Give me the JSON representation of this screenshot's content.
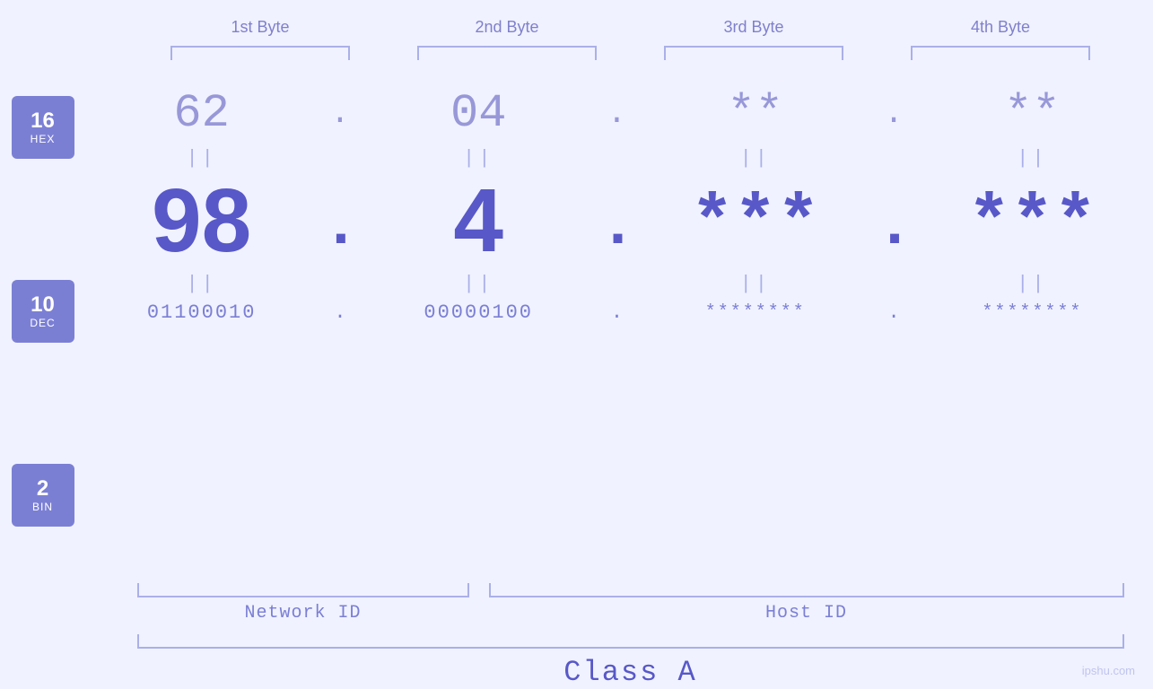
{
  "header": {
    "byte1": "1st Byte",
    "byte2": "2nd Byte",
    "byte3": "3rd Byte",
    "byte4": "4th Byte"
  },
  "badges": {
    "hex": {
      "num": "16",
      "type": "HEX"
    },
    "dec": {
      "num": "10",
      "type": "DEC"
    },
    "bin": {
      "num": "2",
      "type": "BIN"
    }
  },
  "hex_row": {
    "b1": "62",
    "b2": "04",
    "b3": "**",
    "b4": "**",
    "dots": [
      ".",
      ".",
      "."
    ]
  },
  "dec_row": {
    "b1": "98",
    "b2": "4",
    "b3": "***",
    "b4": "***",
    "dots": [
      ".",
      ".",
      "."
    ]
  },
  "bin_row": {
    "b1": "01100010",
    "b2": "00000100",
    "b3": "********",
    "b4": "********",
    "dots": [
      ".",
      ".",
      "."
    ]
  },
  "labels": {
    "network_id": "Network ID",
    "host_id": "Host ID",
    "class": "Class A"
  },
  "watermark": "ipshu.com"
}
